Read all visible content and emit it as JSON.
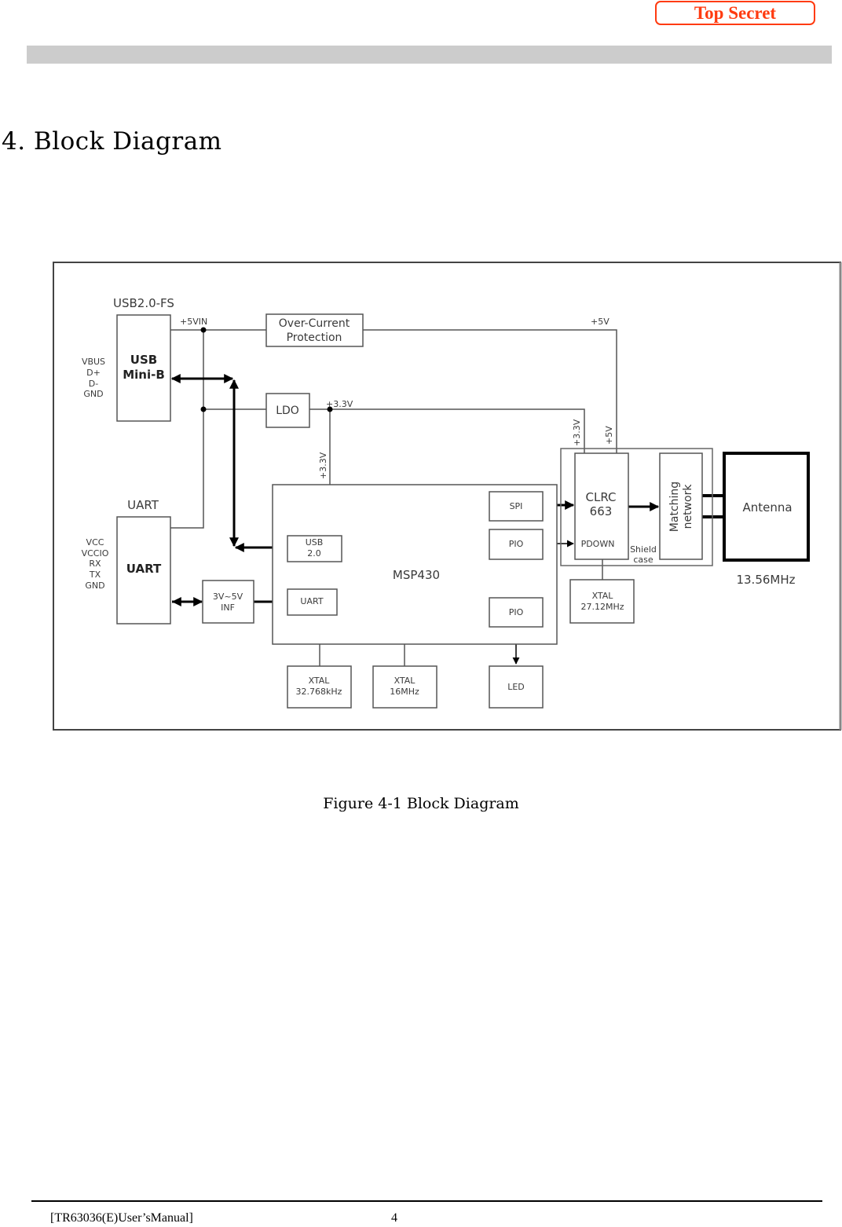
{
  "header": {
    "classification_badge": "Top Secret"
  },
  "section": {
    "title": "4. Block Diagram"
  },
  "diagram": {
    "usb_connector": {
      "group_label": "USB2.0-FS",
      "block_label_line1": "USB",
      "block_label_line2": "Mini-B",
      "pins": [
        "VBUS",
        "D+",
        "D-",
        "GND"
      ]
    },
    "uart_connector": {
      "group_label": "UART",
      "block_label": "UART",
      "pins": [
        "VCC",
        "VCCIO",
        "RX",
        "TX",
        "GND"
      ]
    },
    "power": {
      "vin_label": "+5VIN",
      "ocp_line1": "Over-Current",
      "ocp_line2": "Protection",
      "ldo_label": "LDO",
      "rail_3v3": "+3.3V",
      "rail_5v": "+5V",
      "rail_3v3_mcu": "+3.3V",
      "rail_3v3_clrc": "+3.3V",
      "rail_5v_clrc": "+5V"
    },
    "level_shifter": {
      "line1": "3V~5V",
      "line2": "INF"
    },
    "mcu": {
      "label": "MSP430",
      "usb_line1": "USB",
      "usb_line2": "2.0",
      "uart": "UART",
      "spi": "SPI",
      "pio_pdown": "PIO",
      "pio_led": "PIO"
    },
    "crystals": [
      {
        "line1": "XTAL",
        "line2": "32.768kHz"
      },
      {
        "line1": "XTAL",
        "line2": "16MHz"
      },
      {
        "line1": "XTAL",
        "line2": "27.12MHz"
      }
    ],
    "led": "LED",
    "rf": {
      "chip_line1": "CLRC",
      "chip_line2": "663",
      "pdown": "PDOWN",
      "shield_line1": "Shield",
      "shield_line2": "case",
      "matching_line1": "Matching",
      "matching_line2": "network",
      "antenna": "Antenna",
      "frequency": "13.56MHz"
    }
  },
  "caption": "Figure 4-1 Block Diagram",
  "footer": {
    "document": "[TR63036(E)User’sManual]",
    "page_number": "4"
  }
}
